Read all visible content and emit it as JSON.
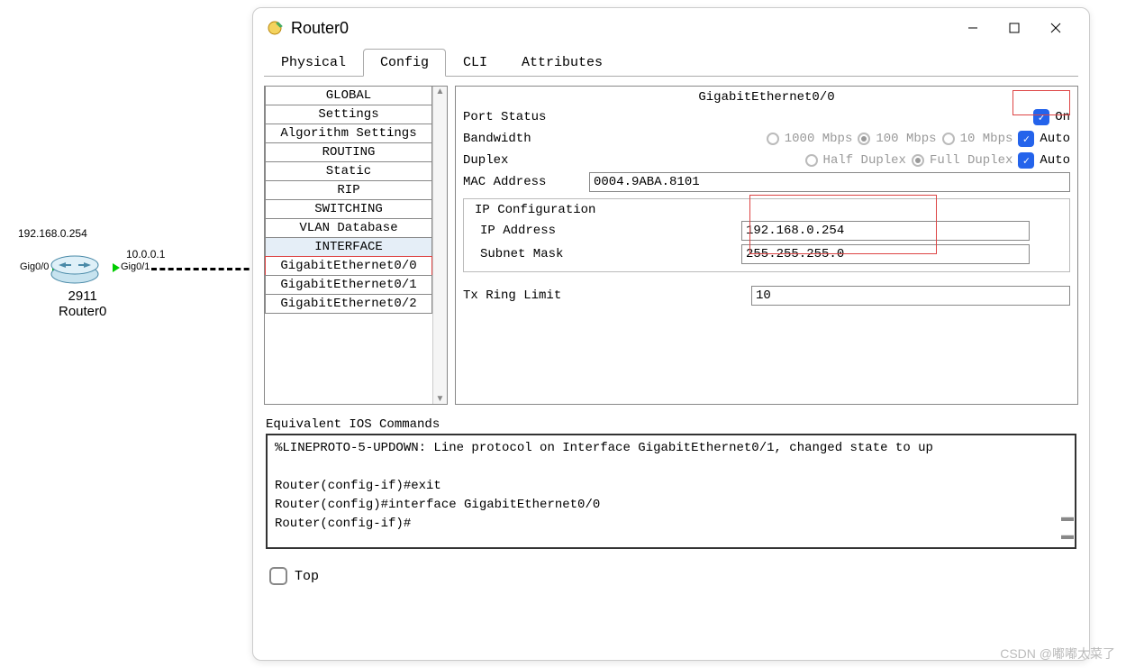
{
  "topology": {
    "ip_left": "192.168.0.254",
    "ip_right": "10.0.0.1",
    "port_left": "Gig0/0",
    "port_right": "Gig0/1",
    "device_model": "2911",
    "device_name": "Router0"
  },
  "window": {
    "title": "Router0",
    "tabs": [
      "Physical",
      "Config",
      "CLI",
      "Attributes"
    ],
    "active_tab": "Config"
  },
  "sidebar": [
    {
      "label": "GLOBAL",
      "type": "header"
    },
    {
      "label": "Settings"
    },
    {
      "label": "Algorithm Settings"
    },
    {
      "label": "ROUTING",
      "type": "header"
    },
    {
      "label": "Static"
    },
    {
      "label": "RIP"
    },
    {
      "label": "SWITCHING",
      "type": "header"
    },
    {
      "label": "VLAN Database"
    },
    {
      "label": "INTERFACE",
      "type": "header",
      "selected": true
    },
    {
      "label": "GigabitEthernet0/0",
      "highlight": true
    },
    {
      "label": "GigabitEthernet0/1"
    },
    {
      "label": "GigabitEthernet0/2"
    }
  ],
  "panel": {
    "title": "GigabitEthernet0/0",
    "port_status_label": "Port Status",
    "port_status_value": "On",
    "bandwidth_label": "Bandwidth",
    "bw_options": [
      "1000 Mbps",
      "100 Mbps",
      "10 Mbps"
    ],
    "bw_auto": "Auto",
    "duplex_label": "Duplex",
    "duplex_options": [
      "Half Duplex",
      "Full Duplex"
    ],
    "duplex_auto": "Auto",
    "mac_label": "MAC Address",
    "mac_value": "0004.9ABA.8101",
    "ipconf_title": "IP Configuration",
    "ip_label": "IP Address",
    "ip_value": "192.168.0.254",
    "mask_label": "Subnet Mask",
    "mask_value": "255.255.255.0",
    "tx_label": "Tx Ring Limit",
    "tx_value": "10"
  },
  "ios": {
    "title": "Equivalent IOS Commands",
    "text": "%LINEPROTO-5-UPDOWN: Line protocol on Interface GigabitEthernet0/1, changed state to up\n\nRouter(config-if)#exit\nRouter(config)#interface GigabitEthernet0/0\nRouter(config-if)#"
  },
  "footer": {
    "top": "Top"
  },
  "watermark": "CSDN @嘟嘟太菜了"
}
